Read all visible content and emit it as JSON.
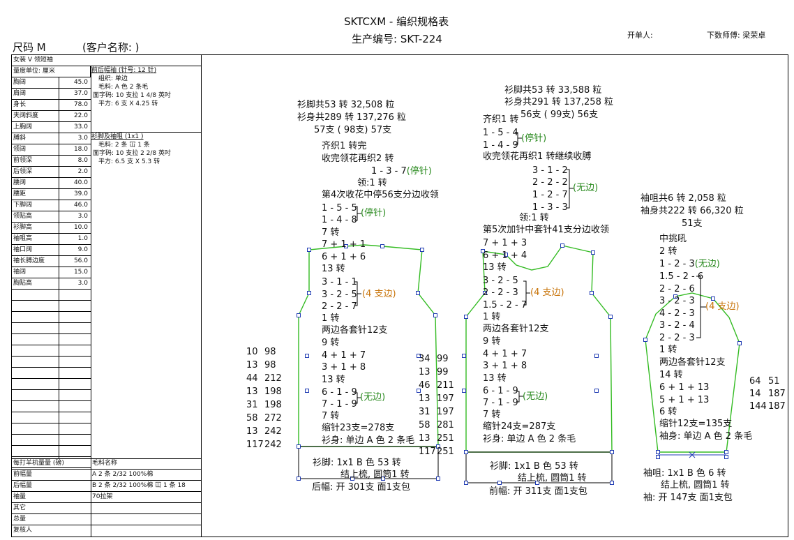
{
  "header": {
    "title": "SKTCXM - 编织规格表",
    "order_no": "生产编号: SKT-224",
    "size": "尺码 M",
    "client": "(客户名称:                )",
    "opener": "开单人:",
    "designer": "下数师傅: 梁荣卓"
  },
  "left_table": {
    "style": "女装 V 领短袖",
    "unit": "量度单位: 厘米",
    "rows": [
      {
        "label": "胸阔",
        "value": "45.0"
      },
      {
        "label": "肩阔",
        "value": "37.0"
      },
      {
        "label": "身长",
        "value": "78.0"
      },
      {
        "label": "夹阔斜度",
        "value": "22.0"
      },
      {
        "label": "上胸阔",
        "value": "33.0"
      },
      {
        "label": "膊斜",
        "value": "3.0"
      },
      {
        "label": "领阔",
        "value": "18.0"
      },
      {
        "label": "前领深",
        "value": "8.0"
      },
      {
        "label": "后领深",
        "value": "2.0"
      },
      {
        "label": "腰阔",
        "value": "40.0"
      },
      {
        "label": "腰距",
        "value": "39.0"
      },
      {
        "label": "下脚阔",
        "value": "46.0"
      },
      {
        "label": "领贴高",
        "value": "3.0"
      },
      {
        "label": "衫脚高",
        "value": "10.0"
      },
      {
        "label": "袖咀高",
        "value": "1.0"
      },
      {
        "label": "袖口阔",
        "value": "9.0"
      },
      {
        "label": "袖长膊边度",
        "value": "56.0"
      },
      {
        "label": "袖阔",
        "value": "15.0"
      },
      {
        "label": "胸贴高",
        "value": "3.0"
      }
    ],
    "body_spec": {
      "title": "前后幅袖 (针号: 12 针)",
      "lines": [
        "组织: 单边",
        "毛料: A 色 2 条毛",
        "面字码: 10 支拉 1 4/8 英吋",
        "平方: 6 支 X 4.25 转"
      ]
    },
    "rib_spec": {
      "title": "衫脚及袖咀 (1x1 )",
      "lines": [
        "毛料: 2 条 冚 1 条",
        "面字码: 10 支拉 2 2/8 英吋",
        "平方: 6.5 支 X 5.3 转"
      ]
    },
    "bottom": {
      "header_left": "每打羊机量量 (磅)",
      "header_right": "毛料名称",
      "rows": [
        {
          "label": "前幅量",
          "value": "A  2 条 2/32  100%棉"
        },
        {
          "label": "后幅量",
          "value": "B  2 条 2/32  100%棉 冚 1 条 18"
        },
        {
          "label": "袖量",
          "value": "    70拉架"
        },
        {
          "label": "其它",
          "value": ""
        },
        {
          "label": "总量",
          "value": ""
        },
        {
          "label": "复核人",
          "value": ""
        }
      ]
    }
  },
  "back": {
    "top": [
      "衫脚共53 转 32,508 粒",
      "衫身共289 转 137,276 粒",
      "57支 ( 98支) 57支"
    ],
    "lines": [
      "齐织1 转完",
      "收完领花再织2 转"
    ],
    "neck_dec": "1 - 3 - 7",
    "neck_dec_note": "(停针)",
    "neck_turns": "领:1 转",
    "split": "第4次收花中停56支分边收领",
    "group1": [
      "1 - 5 - 5",
      "1 - 4 - 8"
    ],
    "group1_note": "(停针)",
    "mid": [
      "7 转",
      "7 + 1 + 1",
      "6 + 1 + 6",
      "13 转"
    ],
    "group2": [
      "3 - 1 - 1",
      "3 - 2 - 5",
      "2 - 2 - 7"
    ],
    "group2_note": "(4 支边)",
    "lower": [
      "1 转",
      "两边各套针12支",
      "9 转",
      "4 + 1 + 7",
      "3 + 1 + 8",
      "13 转"
    ],
    "group3": [
      "6 - 1 - 9",
      "7 - 1 - 9"
    ],
    "group3_note": "(无边)",
    "bottom": [
      "7 转",
      "缩针23支=278支",
      "衫身: 单边 A 色 2 条毛"
    ],
    "rib": [
      "衫脚: 1x1   B 色 53 转",
      "结上梳, 圆筒1 转"
    ],
    "cast_on": "后幅: 开 301支 面1支包",
    "left_pairs": [
      [
        "10",
        "98"
      ],
      [
        "13",
        "98"
      ],
      [
        "44",
        "212"
      ],
      [
        "13",
        "198"
      ],
      [
        "31",
        "198"
      ],
      [
        "58",
        "272"
      ],
      [
        "13",
        "242"
      ],
      [
        "117",
        "242"
      ]
    ],
    "right_pairs": [
      [
        "34",
        "99"
      ],
      [
        "13",
        "99"
      ],
      [
        "46",
        "211"
      ],
      [
        "13",
        "197"
      ],
      [
        "31",
        "197"
      ],
      [
        "58",
        "281"
      ],
      [
        "13",
        "251"
      ],
      [
        "117",
        "251"
      ]
    ]
  },
  "front": {
    "top": [
      "衫脚共53 转 33,588 粒",
      "衫身共291 转 137,258 粒",
      "56支 ( 99支) 56支"
    ],
    "first": "齐织1 转",
    "group1": [
      "1 - 5 - 4",
      "1 - 4 - 9"
    ],
    "group1_note": "(停针)",
    "line2": "收完领花再织1 转继续收膊",
    "group2": [
      "3 - 1 - 2",
      "2 - 2 - 2",
      "1 - 2 - 7",
      "1 - 3 - 3"
    ],
    "group2_note": "(无边)",
    "neck_turns": "领:1 转",
    "split": "第5次加针中套针41支分边收领",
    "mid": [
      "7 + 1 + 3",
      "6 + 1 + 4",
      "13 转"
    ],
    "group3": [
      "3 - 2 - 5",
      "2 - 2 - 3",
      "1.5 - 2 - 7"
    ],
    "group3_note": "(4 支边)",
    "lower": [
      "1 转",
      "两边各套针12支",
      "9 转",
      "4 + 1 + 7",
      "3 + 1 + 8",
      "13 转"
    ],
    "group4": [
      "6 - 1 - 9",
      "7 - 1 - 9"
    ],
    "group4_note": "(无边)",
    "bottom": [
      "7 转",
      "缩针24支=287支",
      "衫身: 单边 A 色 2 条毛"
    ],
    "rib": [
      "衫脚: 1x1    B 色  53 转",
      "结上梳, 圆筒1 转"
    ],
    "cast_on": "前幅: 开 311支 面1支包"
  },
  "sleeve": {
    "top": [
      "袖咀共6 转 2,058 粒",
      "袖身共222 转 66,320 粒",
      "51支"
    ],
    "lines": [
      "中挑吼",
      "2 转"
    ],
    "cap_first": "1 - 2 - 3",
    "cap_first_note": "(无边)",
    "group": [
      "1.5 - 2 - 6",
      "2 - 2 - 6",
      "3 - 2 - 3",
      "4 - 2 - 3",
      "3 - 2 - 4",
      "2 - 2 - 3"
    ],
    "group_note": "(4 支边)",
    "lower": [
      "1 转",
      "两边各套针12支",
      "14 转",
      "6 + 1 + 13",
      "5 + 1 + 13",
      "6 转",
      "缩针12支=135支",
      "袖身: 单边 A 色 2 条毛"
    ],
    "rib": [
      "袖咀: 1x1     B 色 6 转",
      "结上梳, 圆筒1 转"
    ],
    "cast_on": "袖: 开 147支 面1支包",
    "right_pairs": [
      [
        "64",
        "51"
      ],
      [
        "14",
        "187"
      ],
      [
        "144",
        "187"
      ]
    ]
  },
  "colors": {
    "outline": "#33bb22",
    "handle": "#1f3bb3",
    "note_green": "#2a8a1f",
    "note_orange": "#c8740a"
  }
}
